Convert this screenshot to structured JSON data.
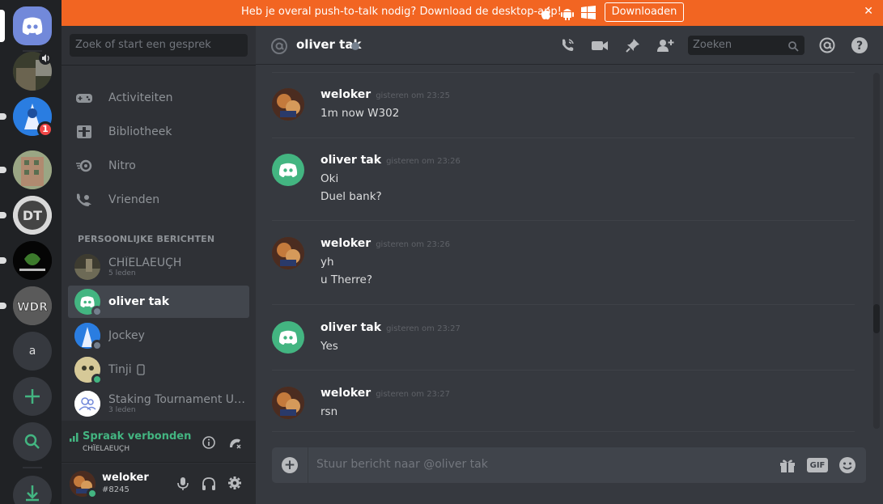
{
  "banner": {
    "text": "Heb je overal push-to-talk nodig? Download de desktop-app!",
    "download_label": "Downloaden",
    "close": "✕"
  },
  "rail": {
    "badge_count": "1",
    "letter_server": "a"
  },
  "sidebar": {
    "search_placeholder": "Zoek of start een gesprek",
    "nav": [
      {
        "label": "Activiteiten",
        "icon": "gamepad-icon"
      },
      {
        "label": "Bibliotheek",
        "icon": "library-icon"
      },
      {
        "label": "Nitro",
        "icon": "nitro-icon"
      },
      {
        "label": "Vrienden",
        "icon": "friends-icon"
      }
    ],
    "section_title": "PERSOONLIJKE BERICHTEN",
    "dms": [
      {
        "name": "CHÏELAEUÇH",
        "sub": "5 leden"
      },
      {
        "name": "oliver tak"
      },
      {
        "name": "Jockey"
      },
      {
        "name": "Tinji"
      },
      {
        "name": "Staking Tournament Un...",
        "sub": "3 leden"
      }
    ],
    "voice": {
      "status": "Spraak verbonden",
      "channel": "CHÏELAEUÇH"
    },
    "user": {
      "name": "weloker",
      "tag": "#8245"
    }
  },
  "chat": {
    "title": "oliver tak",
    "search_placeholder": "Zoeken",
    "messages": [
      {
        "author": "weloker",
        "time": "gisteren om 23:25",
        "lines": [
          "1m now W302"
        ]
      },
      {
        "author": "oliver tak",
        "time": "gisteren om 23:26",
        "lines": [
          "Oki",
          "Duel bank?"
        ]
      },
      {
        "author": "weloker",
        "time": "gisteren om 23:26",
        "lines": [
          "yh",
          "u Therre?"
        ]
      },
      {
        "author": "oliver tak",
        "time": "gisteren om 23:27",
        "lines": [
          "Yes"
        ]
      },
      {
        "author": "weloker",
        "time": "gisteren om 23:27",
        "lines": [
          "rsn"
        ]
      }
    ],
    "composer_placeholder": "Stuur bericht naar @oliver tak",
    "gif_label": "GIF"
  },
  "colors": {
    "accent": "#7289da",
    "banner": "#f26522",
    "online": "#43b581",
    "badge": "#f04747"
  }
}
